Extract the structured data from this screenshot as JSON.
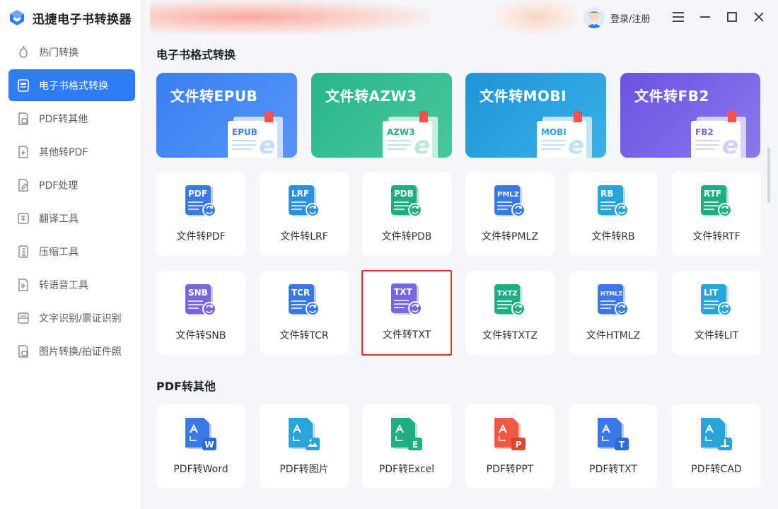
{
  "app": {
    "title": "迅捷电子书转换器",
    "logo_icon": "app-logo-icon"
  },
  "sidebar": {
    "items": [
      {
        "label": "热门转换",
        "icon": "fire-icon",
        "active": false
      },
      {
        "label": "电子书格式转换",
        "icon": "ebook-icon",
        "active": true
      },
      {
        "label": "PDF转其他",
        "icon": "pdf-out-icon",
        "active": false
      },
      {
        "label": "其他转PDF",
        "icon": "pdf-in-icon",
        "active": false
      },
      {
        "label": "PDF处理",
        "icon": "pdf-edit-icon",
        "active": false
      },
      {
        "label": "翻译工具",
        "icon": "translate-icon",
        "active": false
      },
      {
        "label": "压缩工具",
        "icon": "zip-icon",
        "active": false
      },
      {
        "label": "转语音工具",
        "icon": "voice-icon",
        "active": false
      },
      {
        "label": "文字识别/票证识别",
        "icon": "ocr-icon",
        "active": false
      },
      {
        "label": "图片转换/拍证件照",
        "icon": "image-icon",
        "active": false
      }
    ]
  },
  "topbar": {
    "login_label": "登录/注册",
    "menu_icon": "hamburger-menu-icon",
    "minimize_icon": "minimize-icon",
    "maximize_icon": "maximize-icon",
    "close_icon": "close-icon"
  },
  "ebook_section": {
    "title": "电子书格式转换",
    "features": [
      {
        "title": "文件转EPUB",
        "tag": "EPUB"
      },
      {
        "title": "文件转AZW3",
        "tag": "AZW3"
      },
      {
        "title": "文件转MOBI",
        "tag": "MOBI"
      },
      {
        "title": "文件转FB2",
        "tag": "FB2"
      }
    ],
    "row1": [
      {
        "label": "文件转PDF",
        "tag": "PDF"
      },
      {
        "label": "文件转LRF",
        "tag": "LRF"
      },
      {
        "label": "文件转PDB",
        "tag": "PDB"
      },
      {
        "label": "文件转PMLZ",
        "tag": "PMLZ"
      },
      {
        "label": "文件转RB",
        "tag": "RB"
      },
      {
        "label": "文件转RTF",
        "tag": "RTF"
      }
    ],
    "row2": [
      {
        "label": "文件转SNB",
        "tag": "SNB"
      },
      {
        "label": "文件转TCR",
        "tag": "TCR"
      },
      {
        "label": "文件转TXT",
        "tag": "TXT"
      },
      {
        "label": "文件转TXTZ",
        "tag": "TXTZ"
      },
      {
        "label": "文件HTMLZ",
        "tag": "HTMLZ"
      },
      {
        "label": "文件转LIT",
        "tag": "LIT"
      }
    ]
  },
  "pdf_section": {
    "title": "PDF转其他",
    "items": [
      {
        "label": "PDF转Word",
        "badge": "W"
      },
      {
        "label": "PDF转图片",
        "badge": "image-icon"
      },
      {
        "label": "PDF转Excel",
        "badge": "E"
      },
      {
        "label": "PDF转PPT",
        "badge": "P"
      },
      {
        "label": "PDF转TXT",
        "badge": "T"
      },
      {
        "label": "PDF转CAD",
        "badge": "cad-icon"
      }
    ]
  },
  "colors": {
    "accent": "#2f7cf6",
    "selected_border": "#d9342f",
    "blue_doc": "#3a78e6",
    "green_doc": "#1fae84",
    "purple_doc": "#7a64e0",
    "teal_doc": "#2aa3d8",
    "red_doc": "#f05a45"
  }
}
